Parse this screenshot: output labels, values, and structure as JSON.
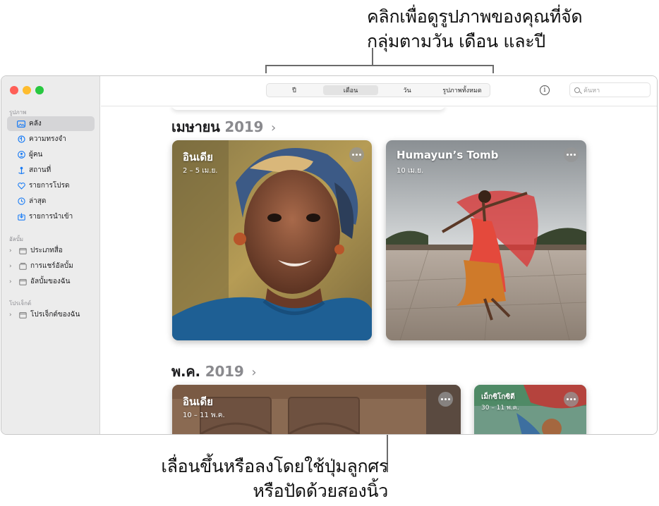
{
  "callouts": {
    "top_line1": "คลิกเพื่อดูรูปภาพของคุณที่จัด",
    "top_line2": "กลุ่มตามวัน เดือน และปี",
    "bottom_line1": "เลื่อนขึ้นหรือลงโดยใช้ปุ่มลูกศร",
    "bottom_line2": "หรือปัดด้วยสองนิ้ว"
  },
  "sidebar": {
    "section_photos": "รูปภาพ",
    "section_albums": "อัลบั้ม",
    "section_projects": "โปรเจ็กต์",
    "items": [
      {
        "label": "คลัง",
        "icon": "photo-library-icon",
        "selected": true
      },
      {
        "label": "ความทรงจำ",
        "icon": "memories-icon"
      },
      {
        "label": "ผู้คน",
        "icon": "people-icon"
      },
      {
        "label": "สถานที่",
        "icon": "places-icon"
      },
      {
        "label": "รายการโปรด",
        "icon": "heart-icon"
      },
      {
        "label": "ล่าสุด",
        "icon": "recent-clock-icon"
      },
      {
        "label": "รายการนำเข้า",
        "icon": "import-icon"
      }
    ],
    "albums": [
      {
        "label": "ประเภทสื่อ",
        "icon": "folder-icon"
      },
      {
        "label": "การแชร์อัลบั้ม",
        "icon": "shared-album-icon"
      },
      {
        "label": "อัลบั้มของฉัน",
        "icon": "folder-icon"
      }
    ],
    "projects": [
      {
        "label": "โปรเจ็กต์ของฉัน",
        "icon": "folder-icon"
      }
    ]
  },
  "toolbar": {
    "tabs": [
      "ปี",
      "เดือน",
      "วัน",
      "รูปภาพทั้งหมด"
    ],
    "active_tab": "เดือน",
    "info_label": "i",
    "search_placeholder": "ค้นหา"
  },
  "months": [
    {
      "name": "เมษายน",
      "year": "2019",
      "chevron": "›",
      "cards": [
        {
          "title": "อินเดีย",
          "date": "2 – 5 เม.ย."
        },
        {
          "title": "Humayun’s Tomb",
          "date": "10 เม.ย."
        }
      ]
    },
    {
      "name": "พ.ค.",
      "year": "2019",
      "chevron": "›",
      "cards": [
        {
          "title": "อินเดีย",
          "date": "10 – 11 พ.ค."
        },
        {
          "title": "เม็กซิโกซิตี",
          "date": "30 – 11 พ.ค."
        }
      ]
    }
  ]
}
